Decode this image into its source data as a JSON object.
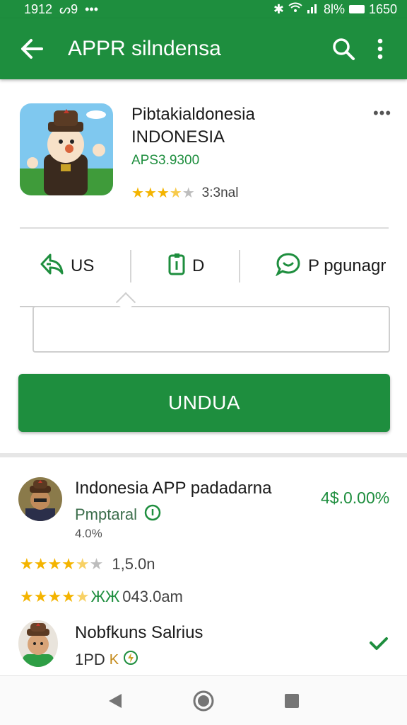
{
  "status_bar": {
    "time": "1912",
    "left_extra": "ᔕ9",
    "dots": "•••",
    "battery": "8l%",
    "clock": "1650"
  },
  "app_bar": {
    "title": "APPR silndensa",
    "icons": [
      "back-arrow-icon",
      "search-icon",
      "more-vert-icon"
    ]
  },
  "app": {
    "name_line1": "Pibtakialdonesia",
    "name_line2": "INDONESIA",
    "developer": "APS3.9300",
    "stars": "★★★★★",
    "rating": 3.5,
    "reviews": "3:3nal",
    "more": "•••"
  },
  "actions": [
    {
      "icon": "share-icon",
      "label": "US"
    },
    {
      "icon": "bookmark-icon",
      "label": "D"
    },
    {
      "icon": "chat-bubble-icon",
      "label": "P pgunagr"
    }
  ],
  "textbox": {
    "placeholder": ""
  },
  "primary_button": {
    "label": "UNDUA"
  },
  "list": [
    {
      "title": "Indonesia APP padadarna",
      "subtitle": "Pmptaral",
      "small": "4.0%",
      "price": "4$.0.00%"
    },
    {
      "title": "Nobfkuns Salrius",
      "subtitle": "1PD",
      "small_badge": "K"
    }
  ],
  "rating_rows": [
    {
      "stars": "★★★★★",
      "rating": 4.5,
      "text": "1,5.0n"
    },
    {
      "stars": "★★★★★",
      "rating": 4.5,
      "prefix": "ЖЖ",
      "text": "043.0am"
    }
  ],
  "nav": [
    "back-triangle-icon",
    "home-circle-icon",
    "recents-square-icon"
  ],
  "colors": {
    "primary": "#1e8e3e",
    "star": "#f4b400"
  }
}
